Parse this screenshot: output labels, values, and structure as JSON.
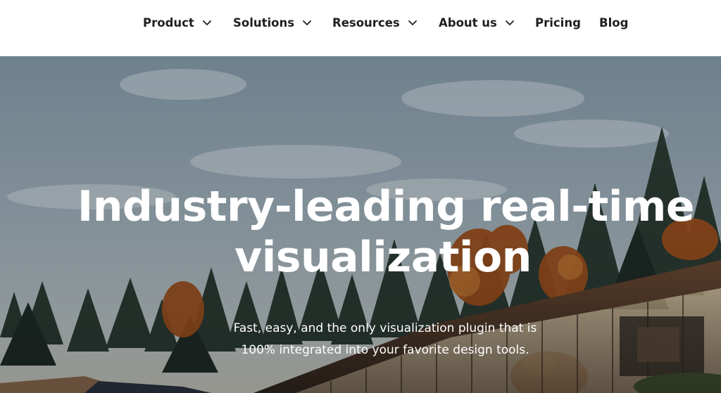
{
  "nav": {
    "items": [
      {
        "label": "Product"
      },
      {
        "label": "Solutions"
      },
      {
        "label": "Resources"
      },
      {
        "label": "About us"
      },
      {
        "label": "Pricing"
      },
      {
        "label": "Blog"
      }
    ]
  },
  "hero": {
    "title_line1": "Industry-leading real-time",
    "title_line2": "visualization",
    "subtitle_line1": "Fast, easy, and the only visualization plugin that is",
    "subtitle_line2": "100% integrated into your favorite design tools."
  },
  "colors": {
    "nav_text": "#1f1f1f",
    "hero_text": "#ffffff",
    "sky_top": "#7d92a0",
    "foliage_orange": "#a0521e"
  },
  "icons": [
    "chevron-down-icon"
  ]
}
